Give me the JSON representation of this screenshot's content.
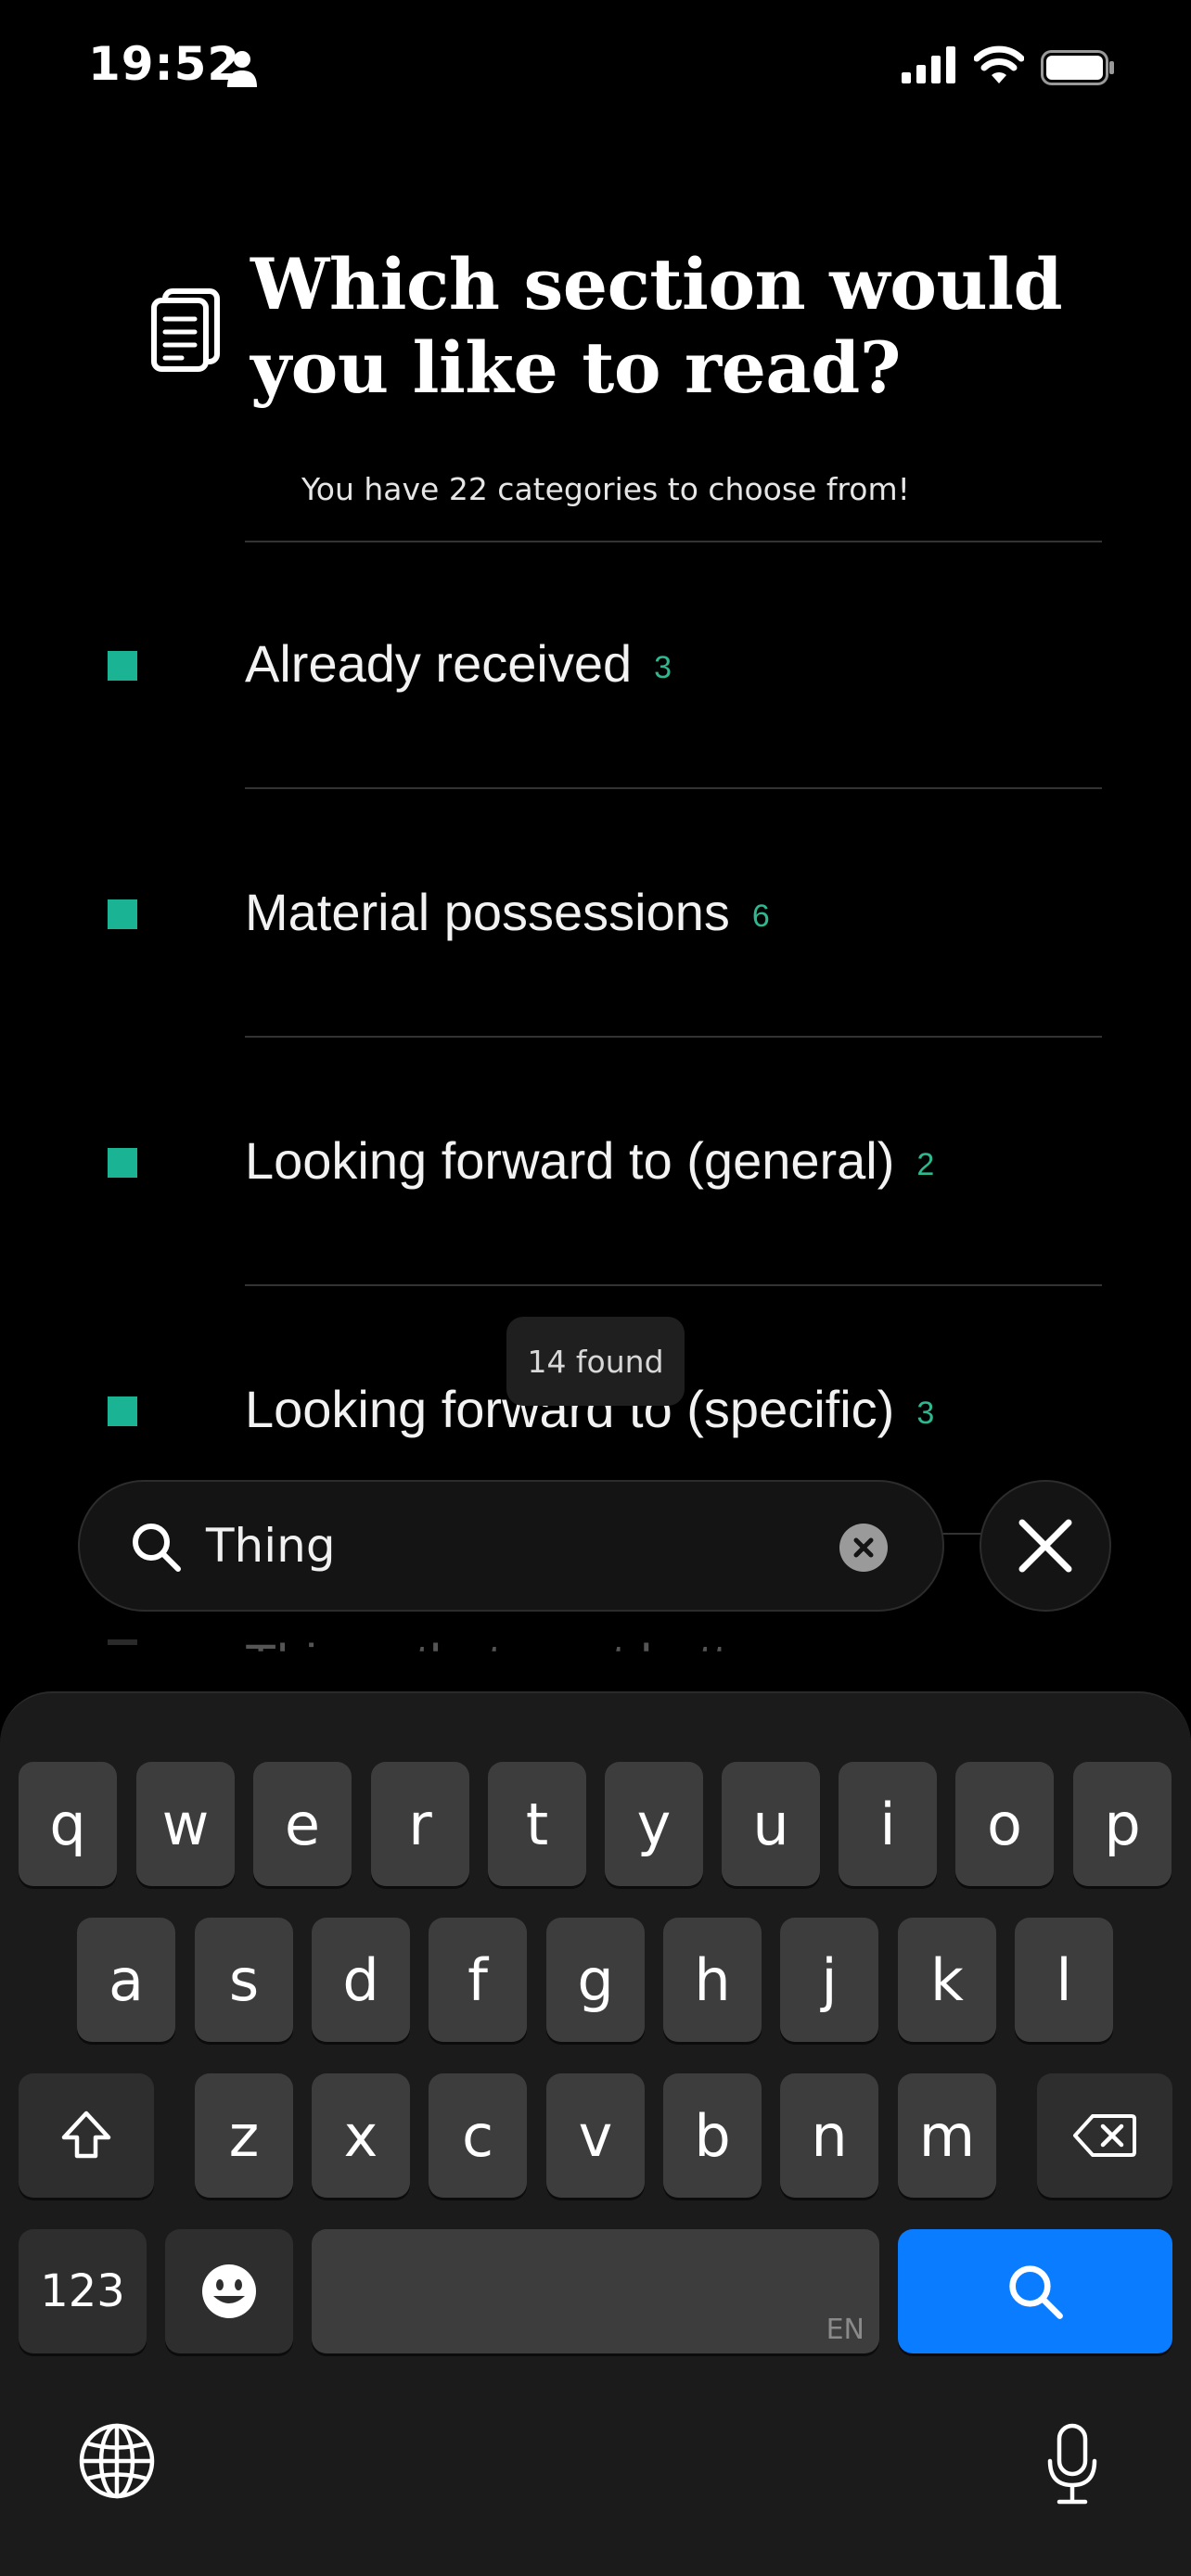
{
  "status_bar": {
    "time": "19:52"
  },
  "header": {
    "title": "Which section would you like to read?",
    "subtitle": "You have 22 categories to choose from!"
  },
  "categories": [
    {
      "label": "Already received",
      "count": "3"
    },
    {
      "label": "Material possessions",
      "count": "6"
    },
    {
      "label": "Looking forward to (general)",
      "count": "2"
    },
    {
      "label": "Looking forward to (specific)",
      "count": "3"
    }
  ],
  "faded_row": {
    "label": "Things that went better"
  },
  "search": {
    "found_label": "14 found",
    "query": "Thing"
  },
  "keyboard": {
    "row1": [
      "q",
      "w",
      "e",
      "r",
      "t",
      "y",
      "u",
      "i",
      "o",
      "p"
    ],
    "row2": [
      "a",
      "s",
      "d",
      "f",
      "g",
      "h",
      "j",
      "k",
      "l"
    ],
    "row3": [
      "z",
      "x",
      "c",
      "v",
      "b",
      "n",
      "m"
    ],
    "numbers_label": "123",
    "space_lang": "EN"
  },
  "colors": {
    "accent": "#1ab394",
    "search_key": "#0a7cff"
  }
}
